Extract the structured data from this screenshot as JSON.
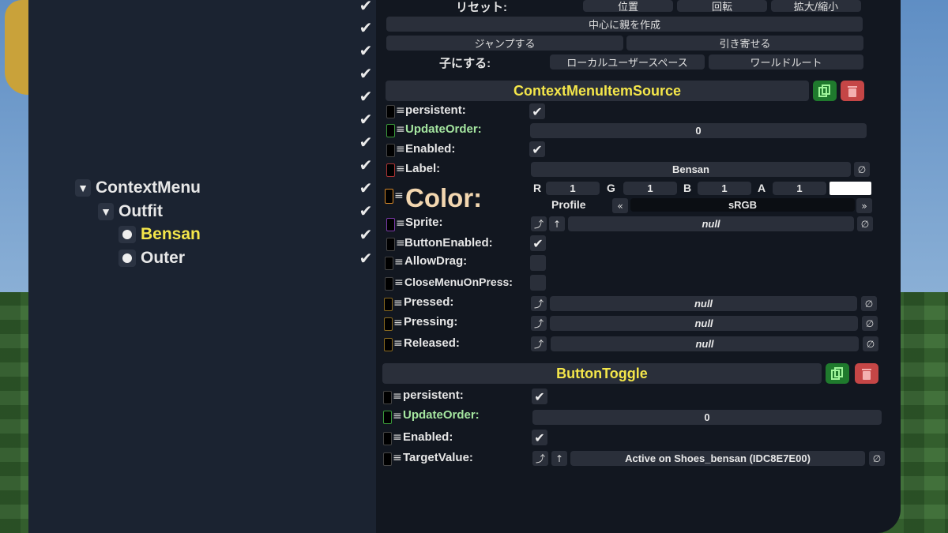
{
  "transform": {
    "reset_label": "リセット:",
    "position": "位置",
    "rotation": "回転",
    "scale": "拡大/縮小",
    "create_parent": "中心に親を作成",
    "jump": "ジャンプする",
    "pull": "引き寄せる",
    "child_label": "子にする:",
    "local_user_space": "ローカルユーザースペース",
    "world_root": "ワールドルート"
  },
  "hierarchy": [
    {
      "label": "ContextMenu",
      "type": "expanded"
    },
    {
      "label": "Outfit",
      "type": "expanded"
    },
    {
      "label": "Bensan",
      "type": "leaf",
      "selected": true
    },
    {
      "label": "Outer",
      "type": "leaf"
    }
  ],
  "component1": {
    "title": "ContextMenuItemSource",
    "persistent": "persistent:",
    "update_order": "UpdateOrder:",
    "update_order_value": "0",
    "enabled": "Enabled:",
    "label": "Label:",
    "label_value": "Bensan",
    "color": "Color:",
    "r_label": "R",
    "r": "1",
    "g_label": "G",
    "g": "1",
    "b_label": "B",
    "b": "1",
    "a_label": "A",
    "a": "1",
    "profile": "Profile",
    "profile_value": "sRGB",
    "sprite": "Sprite:",
    "sprite_value": "null",
    "button_enabled": "ButtonEnabled:",
    "allow_drag": "AllowDrag:",
    "close_menu": "CloseMenuOnPress:",
    "pressed": "Pressed:",
    "pressed_value": "null",
    "pressing": "Pressing:",
    "pressing_value": "null",
    "released": "Released:",
    "released_value": "null"
  },
  "component2": {
    "title": "ButtonToggle",
    "persistent": "persistent:",
    "update_order": "UpdateOrder:",
    "update_order_value": "0",
    "enabled": "Enabled:",
    "target_value": "TargetValue:",
    "target_value_value": "Active on Shoes_bensan (IDC8E7E00)"
  },
  "colors": {
    "accent": "#f4e64a",
    "panel": "#121720",
    "field": "#2a2f3a"
  }
}
